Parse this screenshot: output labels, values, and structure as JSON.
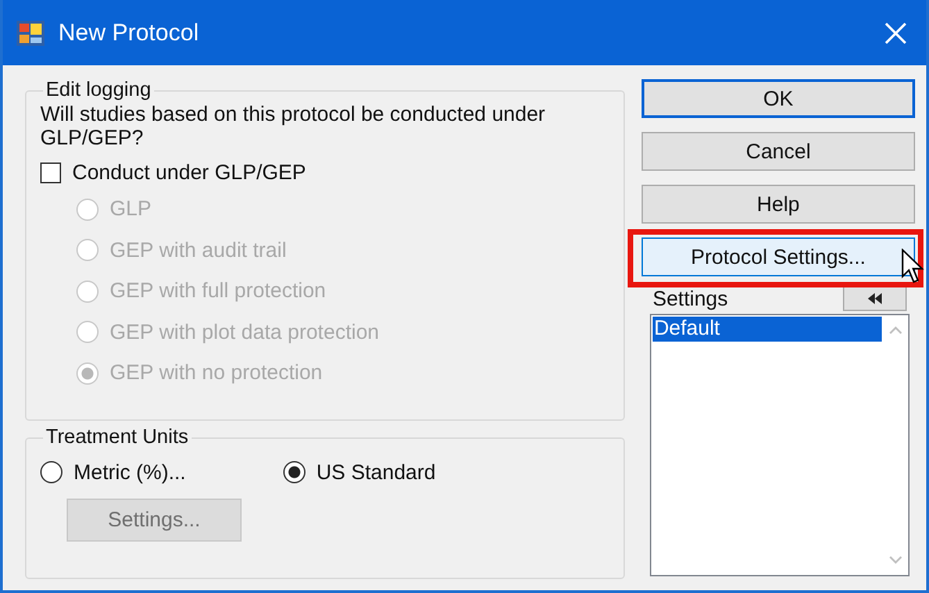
{
  "window": {
    "title": "New Protocol"
  },
  "edit_logging": {
    "title": "Edit logging",
    "question": "Will studies based on this protocol be conducted under GLP/GEP?",
    "conduct_checkbox": {
      "label": "Conduct under GLP/GEP",
      "checked": false
    },
    "options": [
      {
        "label": "GLP",
        "selected": false,
        "disabled": true
      },
      {
        "label": "GEP with audit trail",
        "selected": false,
        "disabled": true
      },
      {
        "label": "GEP with full protection",
        "selected": false,
        "disabled": true
      },
      {
        "label": "GEP with plot data protection",
        "selected": false,
        "disabled": true
      },
      {
        "label": "GEP with no protection",
        "selected": true,
        "disabled": true
      }
    ]
  },
  "treatment_units": {
    "title": "Treatment Units",
    "options": [
      {
        "label": "Metric (%)...",
        "selected": false
      },
      {
        "label": "US Standard",
        "selected": true
      }
    ],
    "settings_button": {
      "label": "Settings...",
      "disabled": true
    }
  },
  "buttons": [
    {
      "label": "OK",
      "default": true,
      "highlighted": false
    },
    {
      "label": "Cancel",
      "default": false,
      "highlighted": false
    },
    {
      "label": "Help",
      "default": false,
      "highlighted": false
    },
    {
      "label": "Protocol Settings...",
      "default": false,
      "highlighted": true
    }
  ],
  "settings": {
    "title": "Settings",
    "items": [
      {
        "label": "Default",
        "selected": true
      }
    ]
  }
}
